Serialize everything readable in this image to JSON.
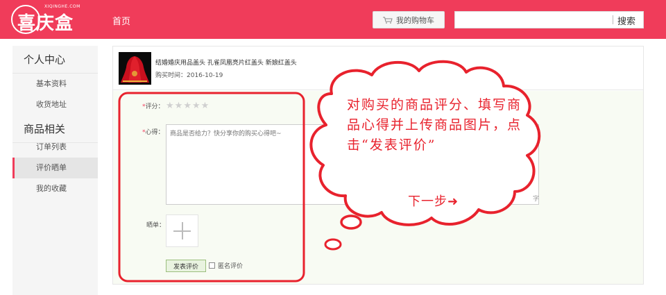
{
  "header": {
    "logo_text": "喜庆盒",
    "logo_sub": "XIQINGHE.COM",
    "nav_home": "首页",
    "cart_label": "我的购物车",
    "search_placeholder": "",
    "search_button": "搜索",
    "brand_color": "#f03c5a"
  },
  "sidebar": {
    "section_personal": "个人中心",
    "personal_items": [
      {
        "label": "基本资料"
      },
      {
        "label": "收货地址"
      }
    ],
    "section_goods": "商品相关",
    "goods_items": [
      {
        "label": "订单列表",
        "active": false
      },
      {
        "label": "评价晒单",
        "active": true
      },
      {
        "label": "我的收藏",
        "active": false
      }
    ]
  },
  "product": {
    "name": "结婚婚庆用品盖头 孔雀凤凰亮片红盖头 新娘红盖头",
    "purchase_time": "购买时间：2016-10-19"
  },
  "review_form": {
    "required_mark": "*",
    "rating_label": "评分：",
    "stars_total": 5,
    "stars_selected": 0,
    "experience_label": "心得：",
    "experience_placeholder": "商品是否给力？快分享你的购买心得吧~",
    "experience_tail_char": "字",
    "photo_label": "晒单：",
    "submit_label": "发表评价",
    "anonymous_label": "匿名评价",
    "anonymous_checked": false
  },
  "annotation": {
    "callout_text": "对购买的商品评分、填写商品心得并上传商品图片，点击“发表评价”",
    "next_step": "下一步",
    "next_arrow": "➜",
    "annotation_color": "#e8222d"
  }
}
